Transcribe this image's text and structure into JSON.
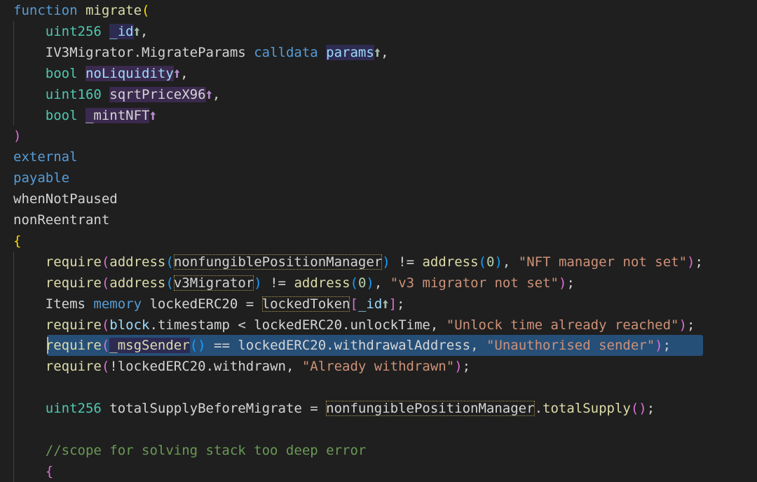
{
  "editor": {
    "lines": [
      [
        [
          "function ",
          "kw"
        ],
        [
          "migrate",
          "fn"
        ],
        [
          "(",
          "br1"
        ]
      ],
      [
        [
          "    ",
          "plain"
        ],
        [
          "uint256 ",
          "ty"
        ],
        [
          "_id",
          "var",
          "p-hl2"
        ],
        [
          "🠩",
          "up up-grn"
        ],
        [
          ",",
          "plain"
        ]
      ],
      [
        [
          "    ",
          "plain"
        ],
        [
          "IV3Migrator.MigrateParams ",
          "plain"
        ],
        [
          "calldata ",
          "kw"
        ],
        [
          "params",
          "var",
          "p-hl2"
        ],
        [
          "🠩",
          "up up-grn"
        ],
        [
          ",",
          "plain"
        ]
      ],
      [
        [
          "    ",
          "plain"
        ],
        [
          "bool ",
          "ty"
        ],
        [
          "noLiquidity",
          "var",
          "p-hl"
        ],
        [
          "🠩",
          "up up-pur"
        ],
        [
          ",",
          "plain"
        ]
      ],
      [
        [
          "    ",
          "plain"
        ],
        [
          "uint160 ",
          "ty"
        ],
        [
          "sqrtPriceX96",
          "plain",
          "p-hl"
        ],
        [
          "🠩",
          "up up-pur"
        ],
        [
          ",",
          "plain"
        ]
      ],
      [
        [
          "    ",
          "plain"
        ],
        [
          "bool ",
          "ty"
        ],
        [
          "_mintNFT",
          "plain",
          "p-hl"
        ],
        [
          "🠩",
          "up up-pur"
        ]
      ],
      [
        [
          ")",
          "br2"
        ]
      ],
      [
        [
          "external",
          "kw"
        ]
      ],
      [
        [
          "payable",
          "kw"
        ]
      ],
      [
        [
          "whenNotPaused",
          "plain"
        ]
      ],
      [
        [
          "nonReentrant",
          "plain"
        ]
      ],
      [
        [
          "{",
          "br1"
        ]
      ],
      [
        [
          "    ",
          "plain"
        ],
        [
          "require",
          "fn"
        ],
        [
          "(",
          "br2"
        ],
        [
          "address",
          "fn"
        ],
        [
          "(",
          "br3"
        ],
        [
          "nonfungiblePositionManager",
          "plain",
          "box"
        ],
        [
          ")",
          "br3"
        ],
        [
          " != ",
          "plain"
        ],
        [
          "address",
          "fn"
        ],
        [
          "(",
          "br3"
        ],
        [
          "0",
          "num"
        ],
        [
          ")",
          "br3"
        ],
        [
          ", ",
          "plain"
        ],
        [
          "\"NFT manager not set\"",
          "str"
        ],
        [
          ")",
          "br2"
        ],
        [
          ";",
          "plain"
        ]
      ],
      [
        [
          "    ",
          "plain"
        ],
        [
          "require",
          "fn"
        ],
        [
          "(",
          "br2"
        ],
        [
          "address",
          "fn"
        ],
        [
          "(",
          "br3"
        ],
        [
          "v3Migrator",
          "plain",
          "box"
        ],
        [
          ")",
          "br3"
        ],
        [
          " != ",
          "plain"
        ],
        [
          "address",
          "fn"
        ],
        [
          "(",
          "br3"
        ],
        [
          "0",
          "num"
        ],
        [
          ")",
          "br3"
        ],
        [
          ", ",
          "plain"
        ],
        [
          "\"v3 migrator not set\"",
          "str"
        ],
        [
          ")",
          "br2"
        ],
        [
          ";",
          "plain"
        ]
      ],
      [
        [
          "    ",
          "plain"
        ],
        [
          "Items ",
          "plain"
        ],
        [
          "memory ",
          "kw"
        ],
        [
          "lockedERC20 = ",
          "plain"
        ],
        [
          "lockedToken",
          "plain",
          "box"
        ],
        [
          "[",
          "br2"
        ],
        [
          "_id",
          "var"
        ],
        [
          "🠩",
          "up up-grn"
        ],
        [
          "]",
          "br2"
        ],
        [
          ";",
          "plain"
        ]
      ],
      [
        [
          "    ",
          "plain"
        ],
        [
          "require",
          "fn"
        ],
        [
          "(",
          "br2"
        ],
        [
          "block",
          "var"
        ],
        [
          ".timestamp < lockedERC20.unlockTime, ",
          "plain"
        ],
        [
          "\"Unlock time already reached\"",
          "str"
        ],
        [
          ")",
          "br2"
        ],
        [
          ";",
          "plain"
        ]
      ],
      [
        [
          "    ",
          "plain"
        ],
        [
          "require",
          "fn"
        ],
        [
          "(",
          "br2"
        ],
        [
          "_msgSender",
          "fn",
          "p-hl2"
        ],
        [
          "()",
          "br3"
        ],
        [
          " == lockedERC20.withdrawalAddress, ",
          "plain"
        ],
        [
          "\"Unauthorised sender\"",
          "str"
        ],
        [
          ")",
          "br2"
        ],
        [
          ";",
          "plain"
        ]
      ],
      [
        [
          "    ",
          "plain"
        ],
        [
          "require",
          "fn"
        ],
        [
          "(",
          "br2"
        ],
        [
          "!lockedERC20.withdrawn, ",
          "plain"
        ],
        [
          "\"Already withdrawn\"",
          "str"
        ],
        [
          ")",
          "br2"
        ],
        [
          ";",
          "plain"
        ]
      ],
      [
        [
          "",
          "plain"
        ]
      ],
      [
        [
          "    ",
          "plain"
        ],
        [
          "uint256 ",
          "ty"
        ],
        [
          "totalSupplyBeforeMigrate = ",
          "plain"
        ],
        [
          "nonfungiblePositionManager",
          "plain",
          "box"
        ],
        [
          ".",
          "plain"
        ],
        [
          "totalSupply",
          "fn"
        ],
        [
          "()",
          "br2"
        ],
        [
          ";",
          "plain"
        ]
      ],
      [
        [
          "",
          "plain"
        ]
      ],
      [
        [
          "    ",
          "plain"
        ],
        [
          "//scope for solving stack too deep error",
          "cmt"
        ]
      ],
      [
        [
          "    ",
          "plain"
        ],
        [
          "{",
          "br2"
        ]
      ]
    ],
    "selected_line": 16,
    "colors": {
      "background": "#1f1f1f",
      "selection": "#264f78"
    }
  }
}
